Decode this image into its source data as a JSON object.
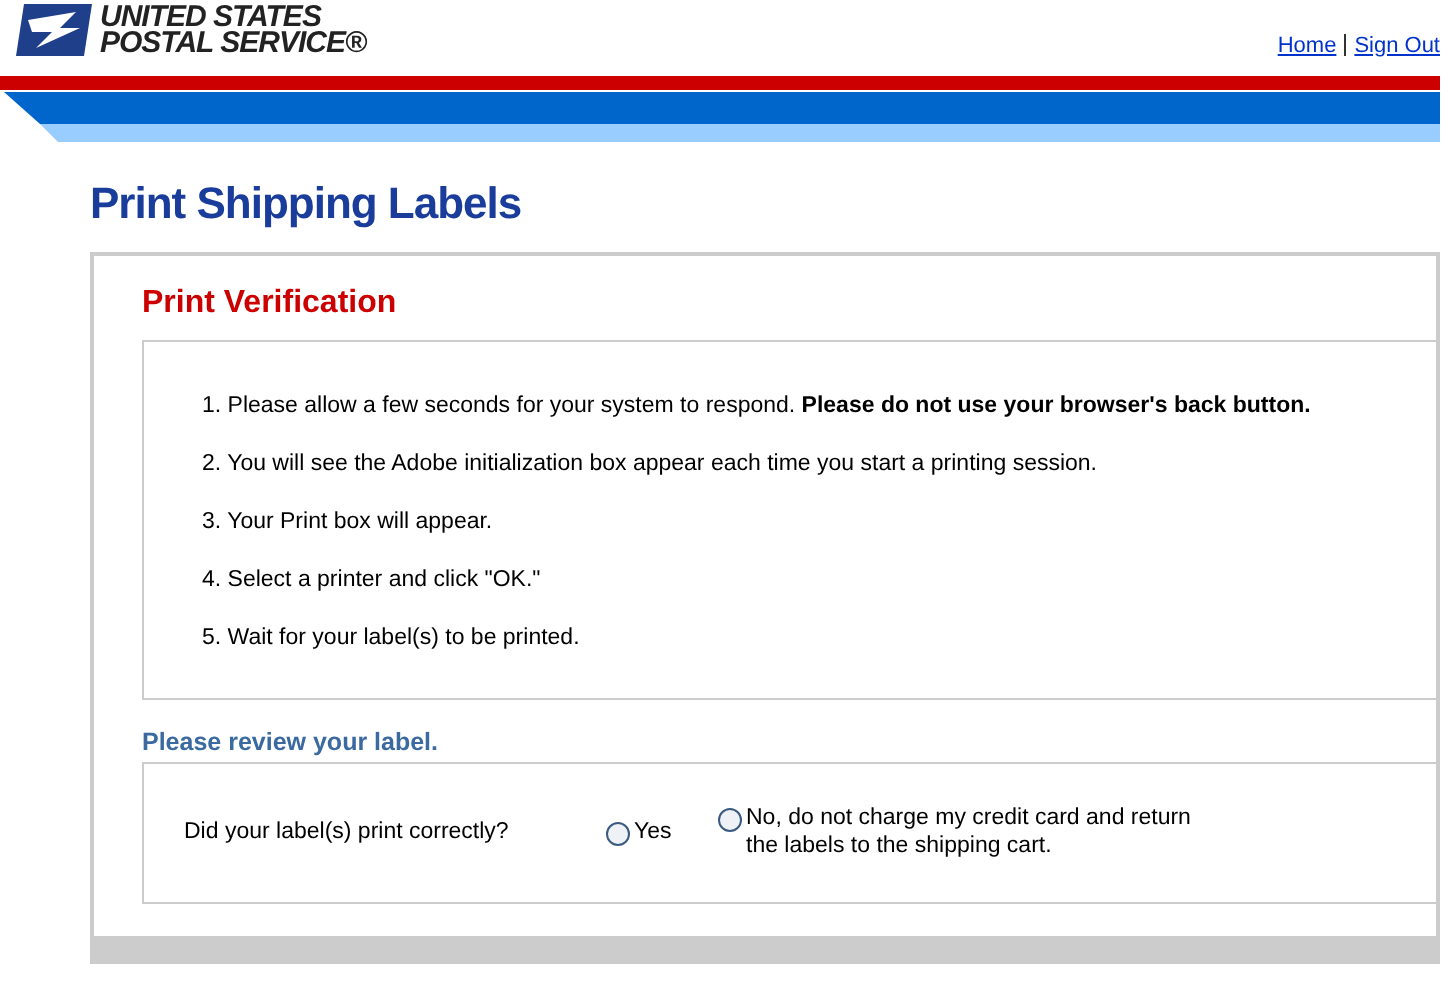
{
  "header": {
    "logo_lines": [
      "UNITED STATES",
      "POSTAL SERVICE®"
    ],
    "links": [
      "Home",
      "Sign Out"
    ]
  },
  "page_title": "Print Shipping Labels",
  "verification": {
    "heading": "Print Verification",
    "steps": [
      "1. Please allow a few seconds for your system to respond.  **Please do not use your browser's back button.**",
      "2. You will see the Adobe initialization box appear each time you start a printing session.",
      "3. Your Print box will appear.",
      "4. Select a printer and click \"OK.\"",
      "5. Wait for your label(s) to be printed."
    ]
  },
  "review": {
    "heading": "Please review your label.",
    "question": "Did your label(s) print correctly?",
    "options": [
      {
        "label": "Yes",
        "selected": false
      },
      {
        "label": "No, do not charge my credit card and return the labels to the shipping cart.",
        "selected": false
      }
    ]
  }
}
